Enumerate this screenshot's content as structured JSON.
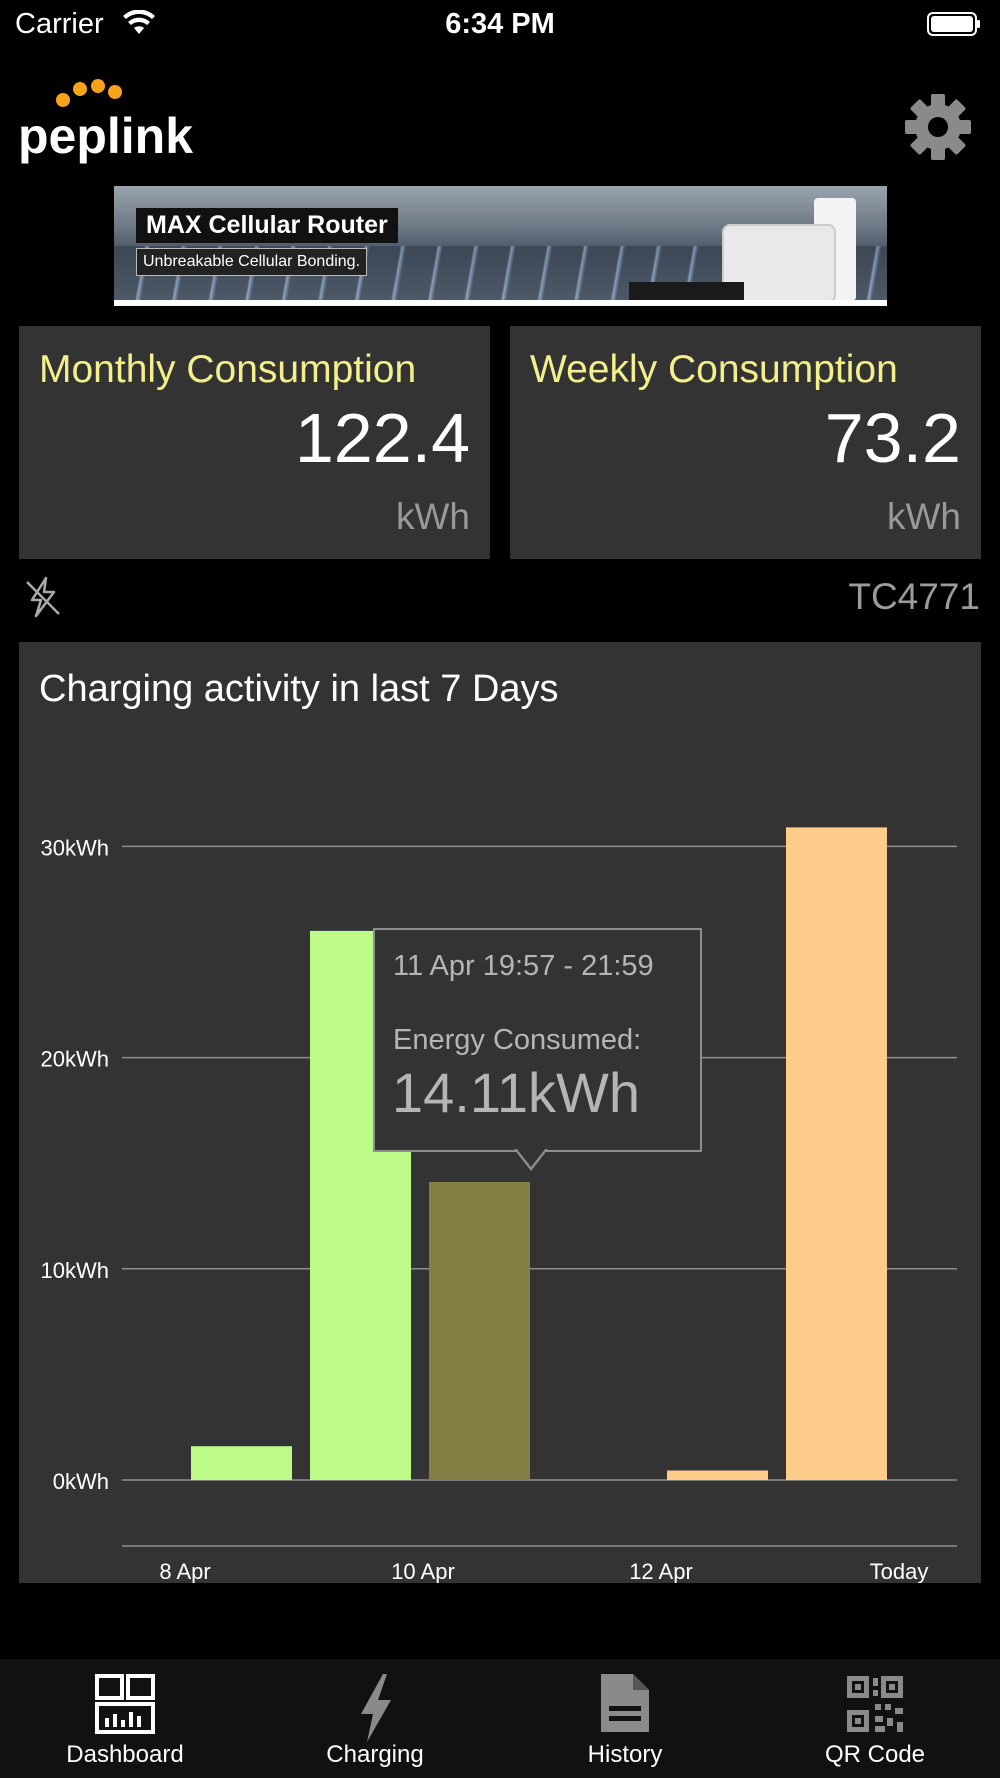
{
  "status_bar": {
    "carrier": "Carrier",
    "time": "6:34 PM"
  },
  "header": {
    "logo_text": "peplink",
    "settings_icon": "gear-icon"
  },
  "banner": {
    "title": "MAX Cellular Router",
    "subtitle": "Unbreakable Cellular Bonding."
  },
  "stats": {
    "monthly": {
      "label": "Monthly Consumption",
      "value": "122.4",
      "unit": "kWh"
    },
    "weekly": {
      "label": "Weekly Consumption",
      "value": "73.2",
      "unit": "kWh"
    }
  },
  "device": {
    "status_icon": "plug-disconnected-icon",
    "id": "TC4771"
  },
  "chart": {
    "title": "Charging activity in last 7 Days"
  },
  "tooltip": {
    "time": "11 Apr 19:57 - 21:59",
    "label": "Energy Consumed:",
    "value": "14.11kWh"
  },
  "colors": {
    "green": "#bdfb88",
    "olive": "#847f45",
    "orange": "#ffcd8b",
    "card_title": "#f2ef8c"
  },
  "chart_data": {
    "type": "bar",
    "ytick_labels": [
      "30kWh",
      "20kWh",
      "10kWh",
      "0kWh"
    ],
    "yticks": [
      30,
      20,
      10,
      0
    ],
    "ylim": [
      0,
      32
    ],
    "xtick_labels": [
      "8 Apr",
      "10 Apr",
      "12 Apr",
      "Today"
    ],
    "xticks": [
      0,
      2,
      4,
      6
    ],
    "bars": [
      {
        "x": 0.5,
        "value": 1.6,
        "color": "green"
      },
      {
        "x": 1.5,
        "value": 26.0,
        "color": "green"
      },
      {
        "x": 2.5,
        "value": 14.11,
        "color": "olive",
        "selected": true
      },
      {
        "x": 4.5,
        "value": 0.45,
        "color": "orange"
      },
      {
        "x": 5.5,
        "value": 30.9,
        "color": "orange"
      }
    ],
    "grid": true
  },
  "tabs": [
    {
      "label": "Dashboard",
      "icon": "dashboard-icon"
    },
    {
      "label": "Charging",
      "icon": "lightning-icon"
    },
    {
      "label": "History",
      "icon": "document-icon"
    },
    {
      "label": "QR Code",
      "icon": "qr-code-icon"
    }
  ]
}
